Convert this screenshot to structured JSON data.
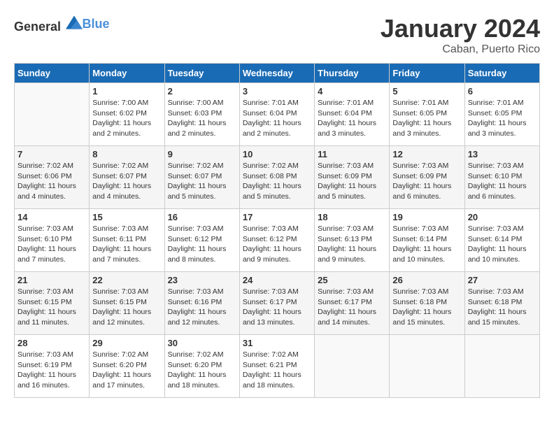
{
  "header": {
    "logo_general": "General",
    "logo_blue": "Blue",
    "title": "January 2024",
    "subtitle": "Caban, Puerto Rico"
  },
  "days_of_week": [
    "Sunday",
    "Monday",
    "Tuesday",
    "Wednesday",
    "Thursday",
    "Friday",
    "Saturday"
  ],
  "weeks": [
    [
      {
        "day": "",
        "empty": true
      },
      {
        "day": "1",
        "sunrise": "Sunrise: 7:00 AM",
        "sunset": "Sunset: 6:02 PM",
        "daylight": "Daylight: 11 hours and 2 minutes."
      },
      {
        "day": "2",
        "sunrise": "Sunrise: 7:00 AM",
        "sunset": "Sunset: 6:03 PM",
        "daylight": "Daylight: 11 hours and 2 minutes."
      },
      {
        "day": "3",
        "sunrise": "Sunrise: 7:01 AM",
        "sunset": "Sunset: 6:04 PM",
        "daylight": "Daylight: 11 hours and 2 minutes."
      },
      {
        "day": "4",
        "sunrise": "Sunrise: 7:01 AM",
        "sunset": "Sunset: 6:04 PM",
        "daylight": "Daylight: 11 hours and 3 minutes."
      },
      {
        "day": "5",
        "sunrise": "Sunrise: 7:01 AM",
        "sunset": "Sunset: 6:05 PM",
        "daylight": "Daylight: 11 hours and 3 minutes."
      },
      {
        "day": "6",
        "sunrise": "Sunrise: 7:01 AM",
        "sunset": "Sunset: 6:05 PM",
        "daylight": "Daylight: 11 hours and 3 minutes."
      }
    ],
    [
      {
        "day": "7",
        "sunrise": "Sunrise: 7:02 AM",
        "sunset": "Sunset: 6:06 PM",
        "daylight": "Daylight: 11 hours and 4 minutes."
      },
      {
        "day": "8",
        "sunrise": "Sunrise: 7:02 AM",
        "sunset": "Sunset: 6:07 PM",
        "daylight": "Daylight: 11 hours and 4 minutes."
      },
      {
        "day": "9",
        "sunrise": "Sunrise: 7:02 AM",
        "sunset": "Sunset: 6:07 PM",
        "daylight": "Daylight: 11 hours and 5 minutes."
      },
      {
        "day": "10",
        "sunrise": "Sunrise: 7:02 AM",
        "sunset": "Sunset: 6:08 PM",
        "daylight": "Daylight: 11 hours and 5 minutes."
      },
      {
        "day": "11",
        "sunrise": "Sunrise: 7:03 AM",
        "sunset": "Sunset: 6:09 PM",
        "daylight": "Daylight: 11 hours and 5 minutes."
      },
      {
        "day": "12",
        "sunrise": "Sunrise: 7:03 AM",
        "sunset": "Sunset: 6:09 PM",
        "daylight": "Daylight: 11 hours and 6 minutes."
      },
      {
        "day": "13",
        "sunrise": "Sunrise: 7:03 AM",
        "sunset": "Sunset: 6:10 PM",
        "daylight": "Daylight: 11 hours and 6 minutes."
      }
    ],
    [
      {
        "day": "14",
        "sunrise": "Sunrise: 7:03 AM",
        "sunset": "Sunset: 6:10 PM",
        "daylight": "Daylight: 11 hours and 7 minutes."
      },
      {
        "day": "15",
        "sunrise": "Sunrise: 7:03 AM",
        "sunset": "Sunset: 6:11 PM",
        "daylight": "Daylight: 11 hours and 7 minutes."
      },
      {
        "day": "16",
        "sunrise": "Sunrise: 7:03 AM",
        "sunset": "Sunset: 6:12 PM",
        "daylight": "Daylight: 11 hours and 8 minutes."
      },
      {
        "day": "17",
        "sunrise": "Sunrise: 7:03 AM",
        "sunset": "Sunset: 6:12 PM",
        "daylight": "Daylight: 11 hours and 9 minutes."
      },
      {
        "day": "18",
        "sunrise": "Sunrise: 7:03 AM",
        "sunset": "Sunset: 6:13 PM",
        "daylight": "Daylight: 11 hours and 9 minutes."
      },
      {
        "day": "19",
        "sunrise": "Sunrise: 7:03 AM",
        "sunset": "Sunset: 6:14 PM",
        "daylight": "Daylight: 11 hours and 10 minutes."
      },
      {
        "day": "20",
        "sunrise": "Sunrise: 7:03 AM",
        "sunset": "Sunset: 6:14 PM",
        "daylight": "Daylight: 11 hours and 10 minutes."
      }
    ],
    [
      {
        "day": "21",
        "sunrise": "Sunrise: 7:03 AM",
        "sunset": "Sunset: 6:15 PM",
        "daylight": "Daylight: 11 hours and 11 minutes."
      },
      {
        "day": "22",
        "sunrise": "Sunrise: 7:03 AM",
        "sunset": "Sunset: 6:15 PM",
        "daylight": "Daylight: 11 hours and 12 minutes."
      },
      {
        "day": "23",
        "sunrise": "Sunrise: 7:03 AM",
        "sunset": "Sunset: 6:16 PM",
        "daylight": "Daylight: 11 hours and 12 minutes."
      },
      {
        "day": "24",
        "sunrise": "Sunrise: 7:03 AM",
        "sunset": "Sunset: 6:17 PM",
        "daylight": "Daylight: 11 hours and 13 minutes."
      },
      {
        "day": "25",
        "sunrise": "Sunrise: 7:03 AM",
        "sunset": "Sunset: 6:17 PM",
        "daylight": "Daylight: 11 hours and 14 minutes."
      },
      {
        "day": "26",
        "sunrise": "Sunrise: 7:03 AM",
        "sunset": "Sunset: 6:18 PM",
        "daylight": "Daylight: 11 hours and 15 minutes."
      },
      {
        "day": "27",
        "sunrise": "Sunrise: 7:03 AM",
        "sunset": "Sunset: 6:18 PM",
        "daylight": "Daylight: 11 hours and 15 minutes."
      }
    ],
    [
      {
        "day": "28",
        "sunrise": "Sunrise: 7:03 AM",
        "sunset": "Sunset: 6:19 PM",
        "daylight": "Daylight: 11 hours and 16 minutes."
      },
      {
        "day": "29",
        "sunrise": "Sunrise: 7:02 AM",
        "sunset": "Sunset: 6:20 PM",
        "daylight": "Daylight: 11 hours and 17 minutes."
      },
      {
        "day": "30",
        "sunrise": "Sunrise: 7:02 AM",
        "sunset": "Sunset: 6:20 PM",
        "daylight": "Daylight: 11 hours and 18 minutes."
      },
      {
        "day": "31",
        "sunrise": "Sunrise: 7:02 AM",
        "sunset": "Sunset: 6:21 PM",
        "daylight": "Daylight: 11 hours and 18 minutes."
      },
      {
        "day": "",
        "empty": true
      },
      {
        "day": "",
        "empty": true
      },
      {
        "day": "",
        "empty": true
      }
    ]
  ]
}
